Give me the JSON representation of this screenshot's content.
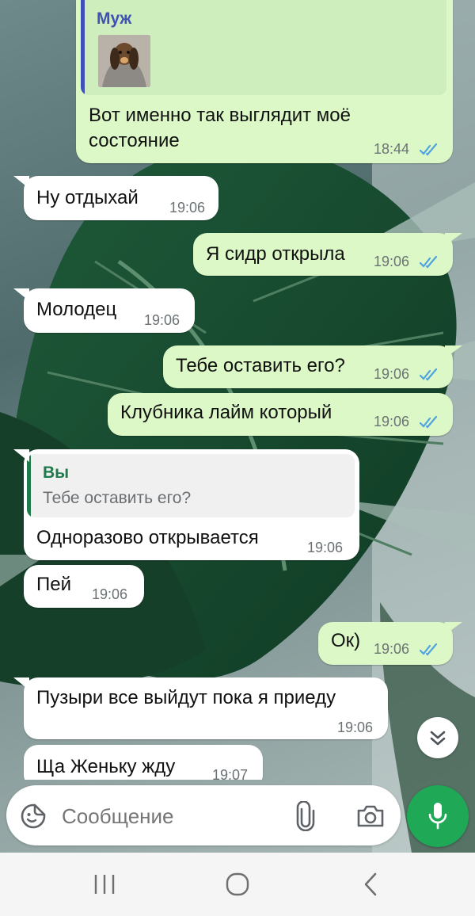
{
  "chat": {
    "messages": [
      {
        "direction": "outgoing",
        "reply_to": {
          "author": "Муж",
          "author_color": "#3f51b5",
          "thumbnail": "dog-photo"
        },
        "text_lines": [
          "Вот именно так выглядит моё",
          "состояние"
        ],
        "time": "18:44",
        "status": "read"
      },
      {
        "direction": "incoming",
        "text": "Ну отдыхай",
        "time": "19:06"
      },
      {
        "direction": "outgoing",
        "text": "Я сидр открыла",
        "time": "19:06",
        "status": "read"
      },
      {
        "direction": "incoming",
        "text": "Молодец",
        "time": "19:06"
      },
      {
        "direction": "outgoing",
        "text": "Тебе оставить его?",
        "time": "19:06",
        "status": "read"
      },
      {
        "direction": "outgoing",
        "text": "Клубника лайм который",
        "time": "19:06",
        "status": "read"
      },
      {
        "direction": "incoming",
        "reply_to": {
          "author": "Вы",
          "author_color": "#1f7a4c",
          "text": "Тебе оставить его?"
        },
        "text": "Одноразово открывается",
        "time": "19:06"
      },
      {
        "direction": "incoming",
        "text": "Пей",
        "time": "19:06"
      },
      {
        "direction": "outgoing",
        "text": "Ок)",
        "time": "19:06",
        "status": "read"
      },
      {
        "direction": "incoming",
        "text": "Пузыри все выйдут пока я приеду",
        "time": "19:06"
      },
      {
        "direction": "incoming",
        "text": "Ща Женьку жду",
        "time": "19:07"
      }
    ]
  },
  "composer": {
    "placeholder": "Сообщение",
    "emoji_icon": "sticker-icon",
    "attach_icon": "paperclip-icon",
    "camera_icon": "camera-icon",
    "mic_icon": "microphone-icon"
  },
  "scroll_button_icon": "double-chevron-down-icon",
  "navbar": {
    "recent_icon": "recent-apps-icon",
    "home_icon": "home-icon",
    "back_icon": "back-icon"
  },
  "colors": {
    "outgoing_bubble": "#dcf8c6",
    "incoming_bubble": "#ffffff",
    "read_ticks": "#4fa3e0",
    "mic_button": "#1fa855"
  }
}
